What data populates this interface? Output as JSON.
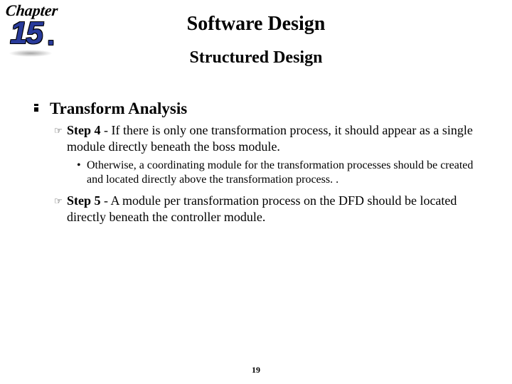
{
  "badge": {
    "word": "Chapter",
    "number": "15",
    "dot": "."
  },
  "titles": {
    "main": "Software Design",
    "sub": "Structured Design"
  },
  "section_heading": "Transform Analysis",
  "steps": [
    {
      "label": "Step 4",
      "text": " - If there is only one transformation process, it should appear as a single module directly beneath the boss module.",
      "sub": "Otherwise, a coordinating module for the transformation processes should be created and located directly above the transformation process. ."
    },
    {
      "label": "Step 5",
      "text": " - A module per transformation process on the DFD should be located directly beneath the controller module."
    }
  ],
  "page_number": "19"
}
